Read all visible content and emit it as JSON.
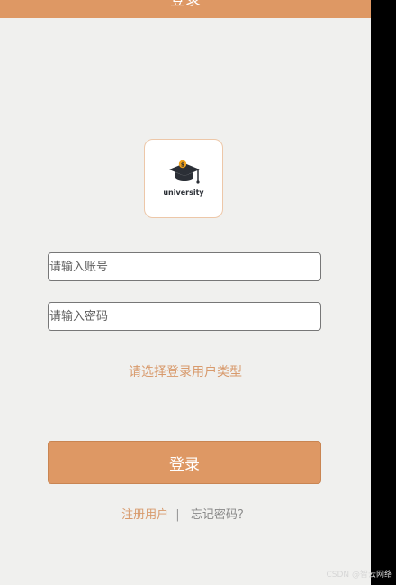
{
  "header": {
    "title": "登录"
  },
  "logo": {
    "text": "university"
  },
  "form": {
    "account_placeholder": "请输入账号",
    "password_placeholder": "请输入密码",
    "user_type_prompt": "请选择登录用户类型",
    "login_label": "登录"
  },
  "links": {
    "register": "注册用户",
    "divider": "|",
    "forgot": "忘记密码？"
  },
  "watermark": "CSDN @智云网络",
  "colors": {
    "accent": "#de9864",
    "background": "#f0f0ee"
  }
}
